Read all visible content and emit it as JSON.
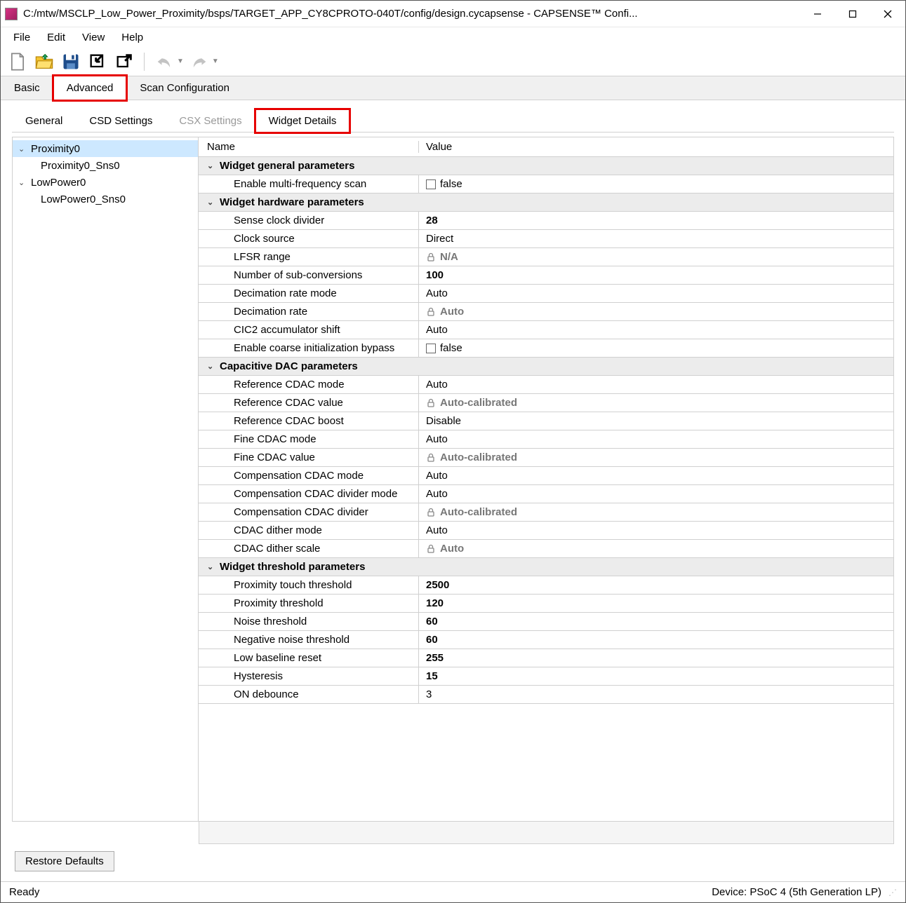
{
  "window": {
    "title": "C:/mtw/MSCLP_Low_Power_Proximity/bsps/TARGET_APP_CY8CPROTO-040T/config/design.cycapsense - CAPSENSE™ Confi..."
  },
  "menu": {
    "file": "File",
    "edit": "Edit",
    "view": "View",
    "help": "Help"
  },
  "primary_tabs": {
    "basic": "Basic",
    "advanced": "Advanced",
    "scan": "Scan Configuration"
  },
  "secondary_tabs": {
    "general": "General",
    "csd": "CSD Settings",
    "csx": "CSX Settings",
    "widget": "Widget Details"
  },
  "tree": {
    "prox": "Proximity0",
    "prox_sns": "Proximity0_Sns0",
    "lp": "LowPower0",
    "lp_sns": "LowPower0_Sns0"
  },
  "grid": {
    "header_name": "Name",
    "header_value": "Value",
    "g1": "Widget general parameters",
    "r_emfs_n": "Enable multi-frequency scan",
    "r_emfs_v": "false",
    "g2": "Widget hardware parameters",
    "r_scd_n": "Sense clock divider",
    "r_scd_v": "28",
    "r_cs_n": "Clock source",
    "r_cs_v": "Direct",
    "r_lfsr_n": "LFSR range",
    "r_lfsr_v": "N/A",
    "r_nsub_n": "Number of sub-conversions",
    "r_nsub_v": "100",
    "r_drm_n": "Decimation rate mode",
    "r_drm_v": "Auto",
    "r_dr_n": "Decimation rate",
    "r_dr_v": "Auto",
    "r_cic_n": "CIC2 accumulator shift",
    "r_cic_v": "Auto",
    "r_ecib_n": "Enable coarse initialization bypass",
    "r_ecib_v": "false",
    "g3": "Capacitive DAC parameters",
    "r_rcm_n": "Reference CDAC mode",
    "r_rcm_v": "Auto",
    "r_rcv_n": "Reference CDAC value",
    "r_rcv_v": "Auto-calibrated",
    "r_rcb_n": "Reference CDAC boost",
    "r_rcb_v": "Disable",
    "r_fcm_n": "Fine CDAC mode",
    "r_fcm_v": "Auto",
    "r_fcv_n": "Fine CDAC value",
    "r_fcv_v": "Auto-calibrated",
    "r_ccm_n": "Compensation CDAC mode",
    "r_ccm_v": "Auto",
    "r_ccdm_n": "Compensation CDAC divider mode",
    "r_ccdm_v": "Auto",
    "r_ccd_n": "Compensation CDAC divider",
    "r_ccd_v": "Auto-calibrated",
    "r_cdm_n": "CDAC dither mode",
    "r_cdm_v": "Auto",
    "r_cds_n": "CDAC dither scale",
    "r_cds_v": "Auto",
    "g4": "Widget threshold parameters",
    "r_ptt_n": "Proximity touch threshold",
    "r_ptt_v": "2500",
    "r_pt_n": "Proximity threshold",
    "r_pt_v": "120",
    "r_nt_n": "Noise threshold",
    "r_nt_v": "60",
    "r_nnt_n": "Negative noise threshold",
    "r_nnt_v": "60",
    "r_lbr_n": "Low baseline reset",
    "r_lbr_v": "255",
    "r_hyst_n": "Hysteresis",
    "r_hyst_v": "15",
    "r_ondb_n": "ON debounce",
    "r_ondb_v": "3"
  },
  "buttons": {
    "restore": "Restore Defaults"
  },
  "status": {
    "ready": "Ready",
    "device": "Device: PSoC 4 (5th Generation LP)"
  }
}
